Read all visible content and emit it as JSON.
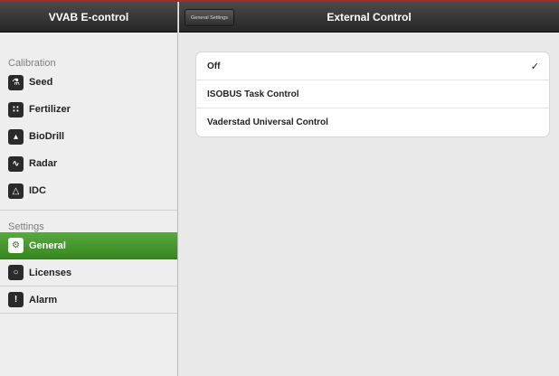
{
  "app_title": "VVAB E-control",
  "sidebar": {
    "calibration_title": "Calibration",
    "calibration_items": [
      {
        "label": "Seed",
        "icon": "seed-icon",
        "glyph": "⚗"
      },
      {
        "label": "Fertilizer",
        "icon": "fertilizer-icon",
        "glyph": "∷"
      },
      {
        "label": "BioDrill",
        "icon": "biodrill-icon",
        "glyph": "▴"
      },
      {
        "label": "Radar",
        "icon": "radar-icon",
        "glyph": "∿"
      },
      {
        "label": "IDC",
        "icon": "idc-icon",
        "glyph": "△"
      }
    ],
    "settings_title": "Settings",
    "settings_items": [
      {
        "label": "General",
        "icon": "general-icon",
        "glyph": "⚙",
        "active": true
      },
      {
        "label": "Licenses",
        "icon": "licenses-icon",
        "glyph": "○",
        "active": false
      },
      {
        "label": "Alarm",
        "icon": "alarm-icon",
        "glyph": "!",
        "active": false
      }
    ]
  },
  "header": {
    "back_label": "General Settings",
    "title": "External Control"
  },
  "options": [
    {
      "label": "Off",
      "selected": true
    },
    {
      "label": "ISOBUS Task Control",
      "selected": false
    },
    {
      "label": "Vaderstad Universal Control",
      "selected": false
    }
  ],
  "check_glyph": "✓",
  "colors": {
    "accent_green": "#3f9327",
    "header_dark": "#2e2e2e",
    "top_red": "#b8241e"
  }
}
